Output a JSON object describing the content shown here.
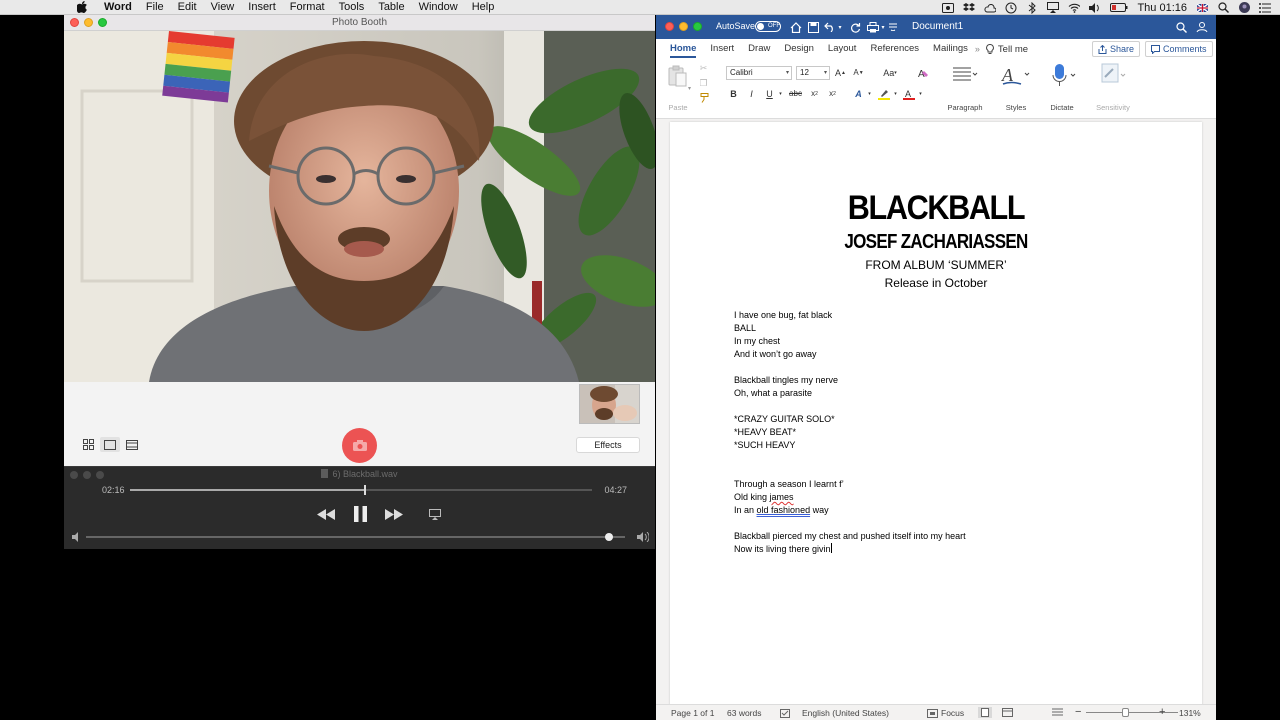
{
  "menubar": {
    "app": "Word",
    "menus": [
      "File",
      "Edit",
      "View",
      "Insert",
      "Format",
      "Tools",
      "Table",
      "Window",
      "Help"
    ],
    "clock": "Thu 01:16"
  },
  "photobooth": {
    "title": "Photo Booth",
    "effects_label": "Effects",
    "shutter_color": "#ec5353"
  },
  "player": {
    "track": "6) Blackball.wav",
    "elapsed": "02:16",
    "duration": "04:27",
    "progress": 0.509,
    "volume": 0.97
  },
  "word": {
    "autosave_label": "AutoSave",
    "autosave_state": "OFF",
    "doc_title": "Document1",
    "accent": "#2b579a",
    "tabs": [
      "Home",
      "Insert",
      "Draw",
      "Design",
      "Layout",
      "References",
      "Mailings"
    ],
    "tell_me": "Tell me",
    "share": "Share",
    "comments": "Comments",
    "ribbon": {
      "paste": "Paste",
      "font_name": "Calibri",
      "font_size": "12",
      "paragraph": "Paragraph",
      "styles": "Styles",
      "dictate": "Dictate",
      "sensitivity": "Sensitivity"
    },
    "doc": {
      "title": "BLACKBALL",
      "artist": "JOSEF ZACHARIASSEN",
      "album": "FROM ALBUM ‘SUMMER’",
      "release": "Release in October",
      "lines": {
        "l1": "I have one bug, fat black",
        "l2": "BALL",
        "l3": "In my chest",
        "l4": "And it won’t go away",
        "l5": "Blackball tingles my nerve",
        "l6": "Oh, what a parasite",
        "l7": "*CRAZY GUITAR SOLO*",
        "l8": "*HEAVY BEAT*",
        "l9": "*SUCH HEAVY",
        "l10": "Through a season I learnt f’",
        "l11a": "Old king ",
        "l11b": "james",
        "l12a": "In an ",
        "l12b": "old fashioned",
        "l12c": " way",
        "l13": "Blackball pierced my chest and pushed itself into my heart",
        "l14": "Now its living there givin"
      }
    },
    "status": {
      "page": "Page 1 of 1",
      "words": "63 words",
      "language": "English (United States)",
      "focus": "Focus",
      "zoom": "131%"
    }
  }
}
